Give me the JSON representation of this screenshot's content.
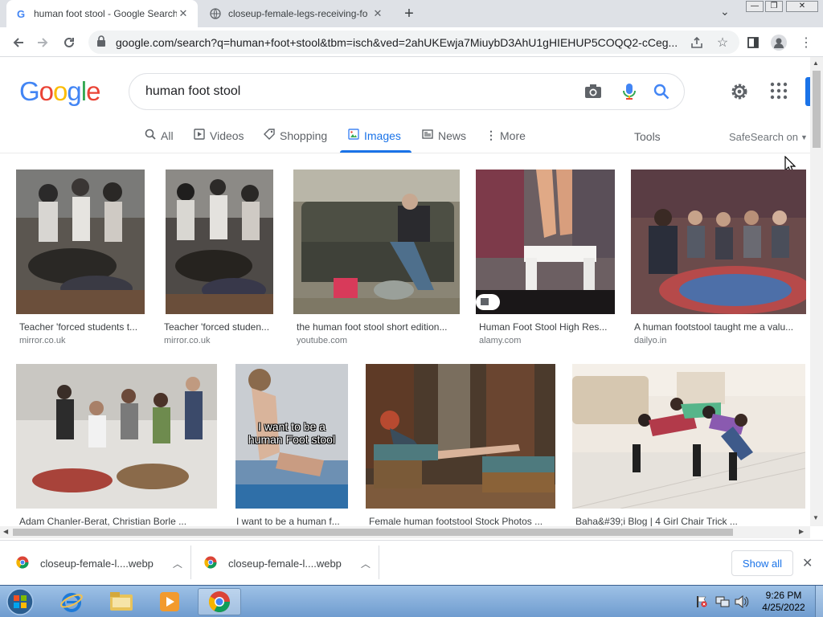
{
  "browser": {
    "tabs": [
      {
        "title": "human foot stool - Google Search",
        "active": true
      },
      {
        "title": "closeup-female-legs-receiving-fo",
        "active": false
      }
    ],
    "new_tab_symbol": "+",
    "tab_list_symbol": "⌄",
    "url": "google.com/search?q=human+foot+stool&tbm=isch&ved=2ahUKEwja7MiuybD3AhU1gHIEHUP5COQQ2-cCeg...",
    "window_controls": [
      "—",
      "❐",
      "✕"
    ]
  },
  "google": {
    "logo_letters": [
      {
        "ch": "G",
        "color": "#4285f4"
      },
      {
        "ch": "o",
        "color": "#ea4335"
      },
      {
        "ch": "o",
        "color": "#fbbc05"
      },
      {
        "ch": "g",
        "color": "#4285f4"
      },
      {
        "ch": "l",
        "color": "#34a853"
      },
      {
        "ch": "e",
        "color": "#ea4335"
      }
    ],
    "query": "human foot stool",
    "nav_tabs": [
      {
        "label": "All",
        "icon": "search-icon"
      },
      {
        "label": "Videos",
        "icon": "video-icon"
      },
      {
        "label": "Shopping",
        "icon": "tag-icon"
      },
      {
        "label": "Images",
        "icon": "image-icon"
      },
      {
        "label": "News",
        "icon": "news-icon"
      },
      {
        "label": "More",
        "icon": "more-vert-icon"
      }
    ],
    "tools_label": "Tools",
    "safesearch_label": "SafeSearch on"
  },
  "results": [
    {
      "caption": "Teacher 'forced students t...",
      "source": "mirror.co.uk",
      "color": "#5b5650"
    },
    {
      "caption": "Teacher 'forced studen...",
      "source": "mirror.co.uk",
      "color": "#4e4a47"
    },
    {
      "caption": "the human foot stool short edition...",
      "source": "youtube.com",
      "color": "#5c5d52"
    },
    {
      "caption": "Human Foot Stool High Res...",
      "source": "alamy.com",
      "color": "#8a7b78"
    },
    {
      "caption": "A human footstool taught me a valu...",
      "source": "dailyo.in",
      "color": "#6b4b4b"
    },
    {
      "caption": "Adam Chanler-Berat, Christian Borle ...",
      "source": "",
      "color": "#c9c6c2"
    },
    {
      "caption": "I want to be a human f...",
      "source": "",
      "color": "#b9bbbf"
    },
    {
      "caption": "Female human footstool Stock Photos ...",
      "source": "",
      "color": "#4b3a2c"
    },
    {
      "caption": "Baha&#39;i Blog | 4 Girl Chair Trick ...",
      "source": "",
      "color": "#d9cfc4"
    }
  ],
  "meme_text": "I want to be a human Foot stool",
  "downloads": [
    {
      "name": "closeup-female-l....webp"
    },
    {
      "name": "closeup-female-l....webp"
    }
  ],
  "show_all_label": "Show all",
  "taskbar": {
    "time": "9:26 PM",
    "date": "4/25/2022"
  }
}
